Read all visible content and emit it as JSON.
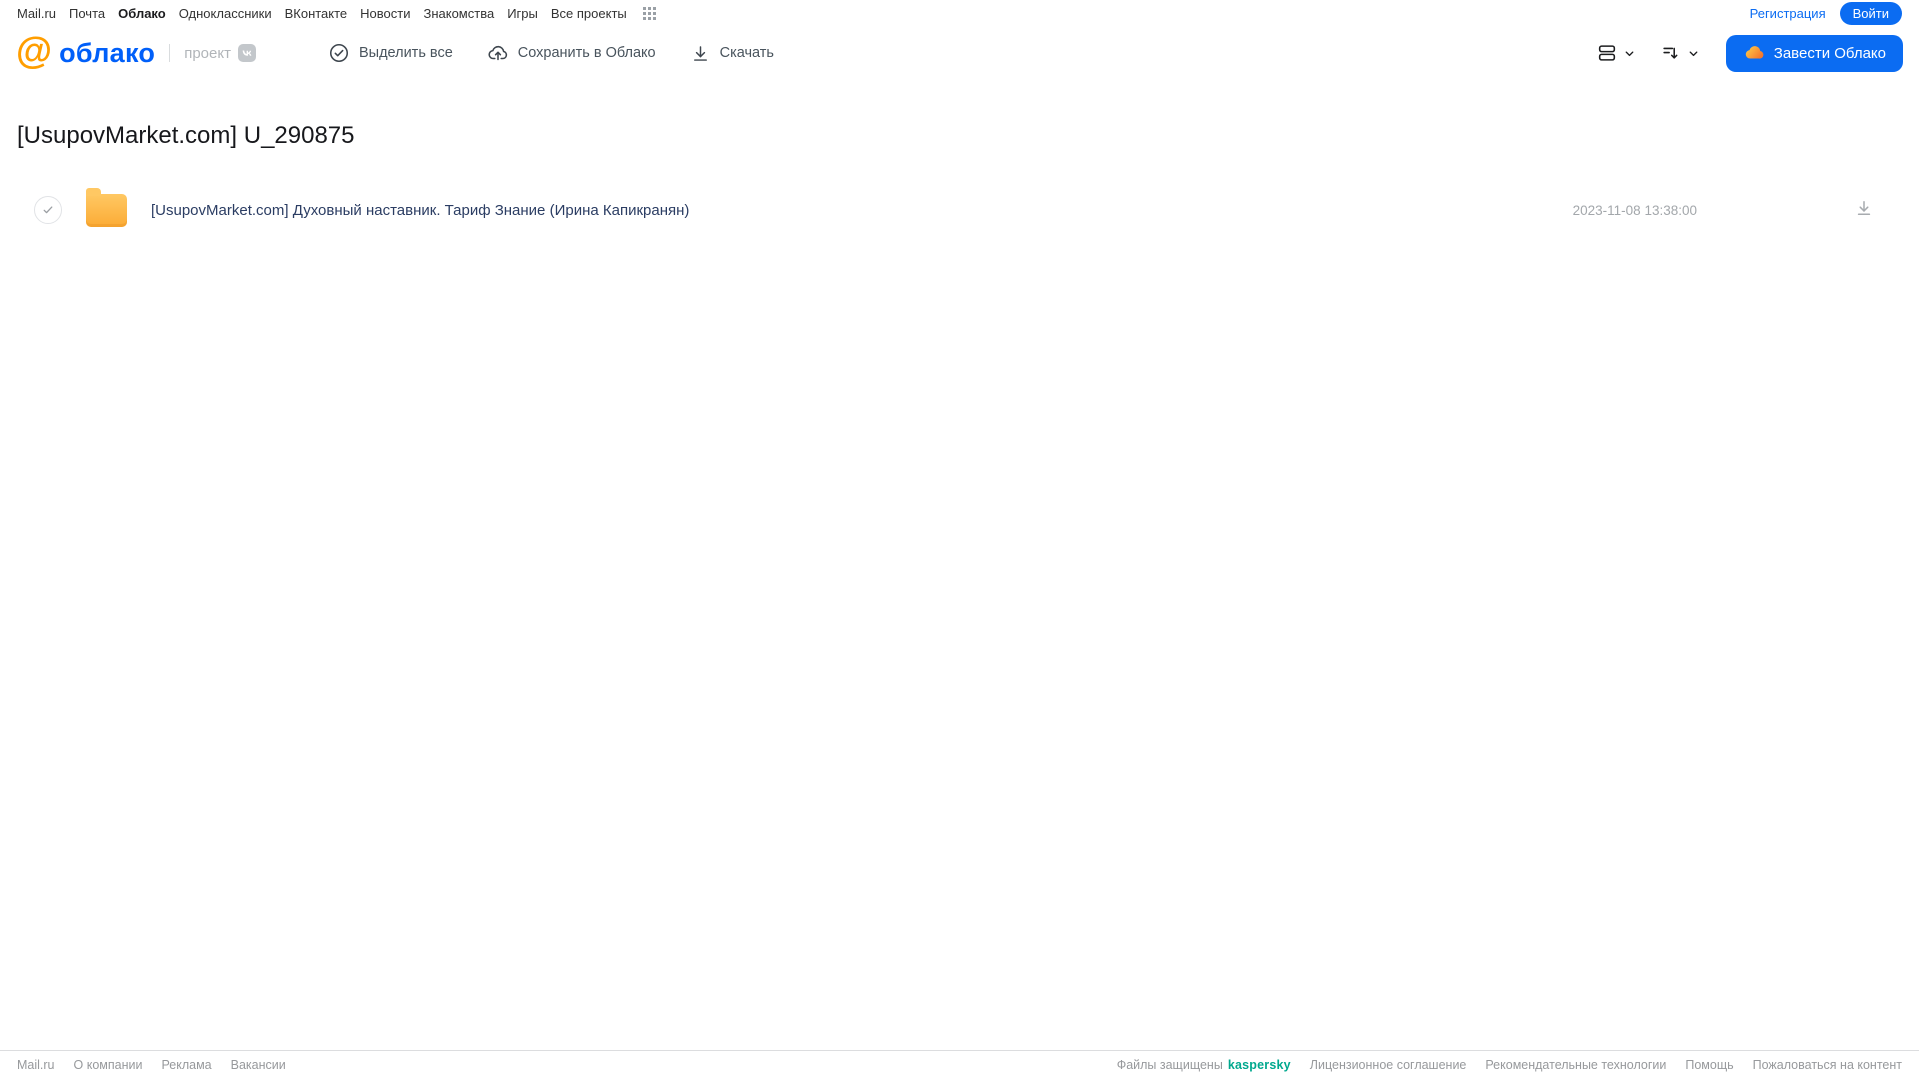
{
  "portal_nav": {
    "items": [
      "Mail.ru",
      "Почта",
      "Облако",
      "Одноклассники",
      "ВКонтакте",
      "Новости",
      "Знакомства",
      "Игры",
      "Все проекты"
    ],
    "active_item": "Облако",
    "registration_label": "Регистрация",
    "login_label": "Войти"
  },
  "header": {
    "logo": {
      "at_symbol": "@",
      "brand": "облако",
      "project_label": "проект"
    },
    "toolbar": {
      "select_all": "Выделить все",
      "save_to_cloud": "Сохранить в Облако",
      "download": "Скачать"
    },
    "get_cloud_button": "Завести Облако"
  },
  "main": {
    "title": "[UsupovMarket.com] U_290875",
    "files": [
      {
        "type": "folder",
        "name": "[UsupovMarket.com] Духовный наставник. Тариф Знание (Ирина Капикранян)",
        "modified": "2023-11-08 13:38:00"
      }
    ]
  },
  "footer": {
    "left_links": [
      "Mail.ru",
      "О компании",
      "Реклама",
      "Вакансии"
    ],
    "protected_by": "Файлы защищены",
    "kaspersky": "kaspersky",
    "right_links": [
      "Лицензионное соглашение",
      "Рекомендательные технологии",
      "Помощь",
      "Пожаловаться на контент"
    ]
  },
  "colors": {
    "primary_blue": "#0b6cf2",
    "logo_blue": "#005ff9",
    "logo_orange": "#ff9e00",
    "folder_yellow": "#ffbe4b",
    "kaspersky_teal": "#00a88e"
  },
  "icons": {
    "select_all": "check-circle-icon",
    "save_to_cloud": "cloud-upload-icon",
    "download": "download-icon",
    "view_mode": "view-mode-icon",
    "sort": "sort-icon",
    "apps": "apps-grid-icon",
    "project_badge": "vk-badge-icon",
    "file": "folder-icon",
    "button": "cloud-icon"
  }
}
